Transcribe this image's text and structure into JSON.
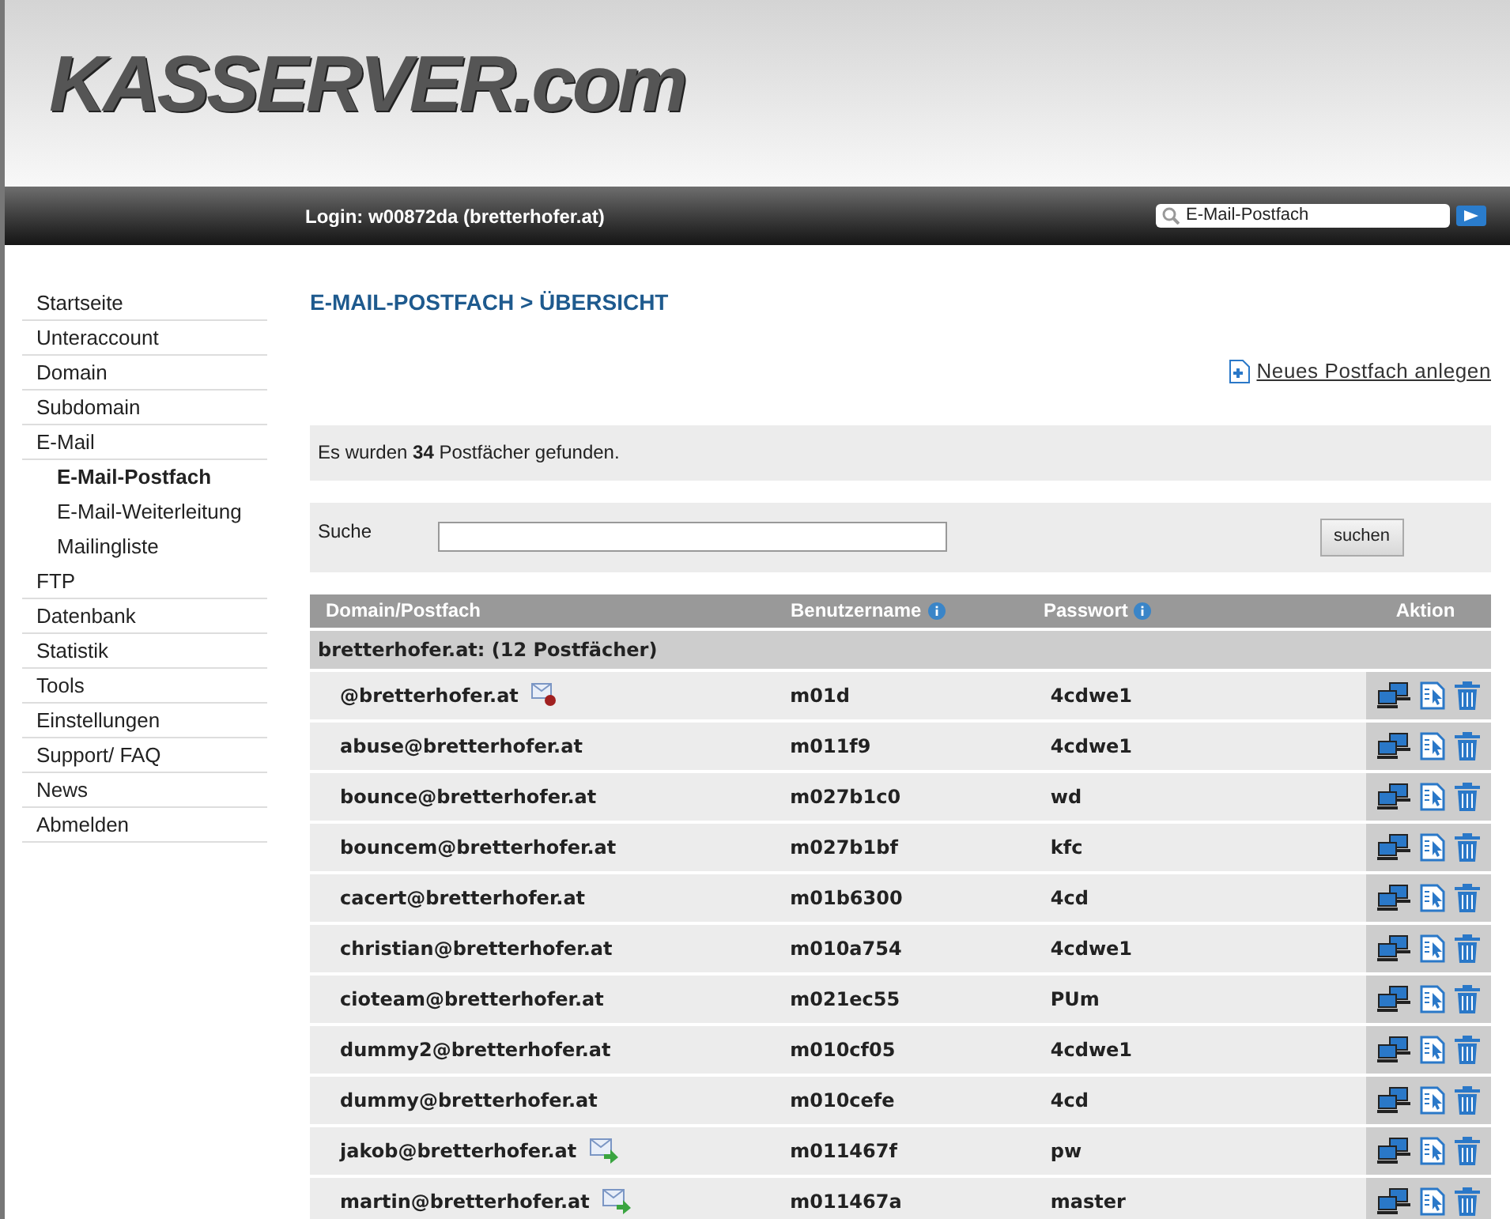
{
  "header": {
    "logo": "KASSERVER.com",
    "login": "Login: w00872da (bretterhofer.at)",
    "search": {
      "value": "E-Mail-Postfach"
    }
  },
  "sidebar": {
    "items": [
      {
        "label": "Startseite",
        "selected": false
      },
      {
        "label": "Unteraccount",
        "selected": false
      },
      {
        "label": "Domain",
        "selected": false
      },
      {
        "label": "Subdomain",
        "selected": false
      },
      {
        "label": "E-Mail",
        "selected": false,
        "children": [
          {
            "label": "E-Mail-Postfach",
            "selected": true
          },
          {
            "label": "E-Mail-Weiterleitung",
            "selected": false
          },
          {
            "label": "Mailingliste",
            "selected": false
          }
        ]
      },
      {
        "label": "FTP",
        "selected": false
      },
      {
        "label": "Datenbank",
        "selected": false
      },
      {
        "label": "Statistik",
        "selected": false
      },
      {
        "label": "Tools",
        "selected": false
      },
      {
        "label": "Einstellungen",
        "selected": false
      },
      {
        "label": "Support/ FAQ",
        "selected": false
      },
      {
        "label": "News",
        "selected": false
      },
      {
        "label": "Abmelden",
        "selected": false
      }
    ]
  },
  "page_title": "E-MAIL-POSTFACH > ÜBERSICHT",
  "new_link": "Neues Postfach anlegen",
  "found": "Es wurden **34** Postfächer gefunden.",
  "search": {
    "label": "Suche",
    "button": "suchen"
  },
  "table": {
    "columns": [
      "Domain/Postfach",
      "Benutzername",
      "Passwort",
      "Aktion"
    ],
    "group": "bretterhofer.at: (12 Postfächer)",
    "rows": [
      {
        "mailbox": "@bretterhofer.at",
        "status_icon": {
          "kind": "blocked"
        },
        "username": "m01d",
        "password": "4cdwe1"
      },
      {
        "mailbox": "abuse@bretterhofer.at",
        "username": "m011f9",
        "password": "4cdwe1"
      },
      {
        "mailbox": "bounce@bretterhofer.at",
        "username": "m027b1c0",
        "password": "wd"
      },
      {
        "mailbox": "bouncem@bretterhofer.at",
        "username": "m027b1bf",
        "password": "kfc"
      },
      {
        "mailbox": "cacert@bretterhofer.at",
        "username": "m01b6300",
        "password": "4cd"
      },
      {
        "mailbox": "christian@bretterhofer.at",
        "username": "m010a754",
        "password": "4cdwe1"
      },
      {
        "mailbox": "cioteam@bretterhofer.at",
        "username": "m021ec55",
        "password": "PUm"
      },
      {
        "mailbox": "dummy2@bretterhofer.at",
        "username": "m010cf05",
        "password": "4cdwe1"
      },
      {
        "mailbox": "dummy@bretterhofer.at",
        "username": "m010cefe",
        "password": "4cd"
      },
      {
        "mailbox": "jakob@bretterhofer.at",
        "status_icon": {
          "kind": "forward"
        },
        "username": "m011467f",
        "password": "pw"
      },
      {
        "mailbox": "martin@bretterhofer.at",
        "status_icon": {
          "kind": "forward"
        },
        "username": "m011467a",
        "password": "master"
      }
    ]
  }
}
